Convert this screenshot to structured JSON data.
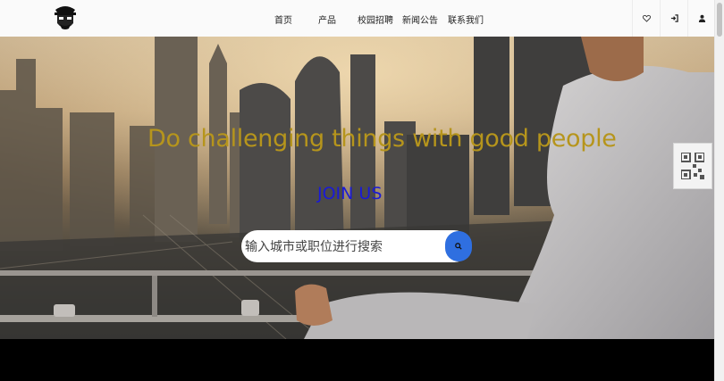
{
  "nav": {
    "items": [
      {
        "label": "首页"
      },
      {
        "label": "产品"
      },
      {
        "label": "校园招聘"
      },
      {
        "label": "新闻公告"
      },
      {
        "label": "联系我们"
      }
    ]
  },
  "header_icons": [
    "heart-icon",
    "login-icon",
    "user-icon"
  ],
  "hero": {
    "headline": "Do challenging things with good people",
    "join_label": "JOIN US",
    "search_placeholder": "输入城市或职位进行搜索"
  },
  "colors": {
    "headline": "#b6951c",
    "join": "#1a1ad6",
    "search_button": "#2f6fe0"
  }
}
